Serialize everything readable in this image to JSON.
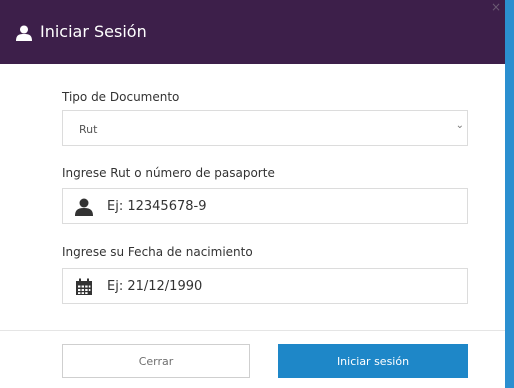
{
  "modal": {
    "title": "Iniciar Sesión",
    "header_icon": "user-icon",
    "close_glyph": "×"
  },
  "form": {
    "doc_type": {
      "label": "Tipo de Documento",
      "selected": "Rut",
      "icon": "chevron-down-icon"
    },
    "rut": {
      "label": "Ingrese Rut o número de pasaporte",
      "placeholder": "Ej: 12345678-9",
      "icon": "user-icon"
    },
    "birthdate": {
      "label": "Ingrese su Fecha de nacimiento",
      "placeholder": "Ej: 21/12/1990",
      "icon": "calendar-icon"
    }
  },
  "footer": {
    "cancel_label": "Cerrar",
    "login_label": "Iniciar sesión"
  },
  "colors": {
    "header_bg": "#3d1f4a",
    "primary": "#1e87c8",
    "page_bg": "#2b8fd0"
  }
}
